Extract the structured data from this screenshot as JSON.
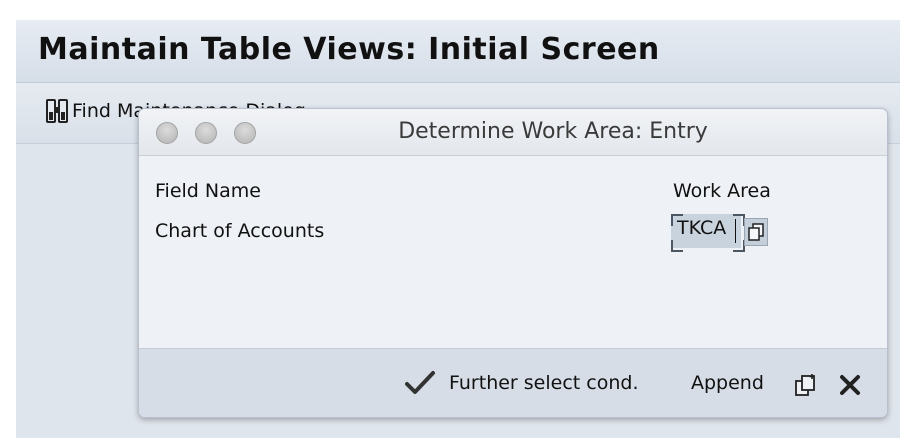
{
  "screen": {
    "title": "Maintain Table Views: Initial Screen",
    "toolbar": {
      "find_label": "Find Maintenance Dialog"
    }
  },
  "dialog": {
    "title": "Determine Work Area: Entry",
    "column_headers": {
      "field_name": "Field Name",
      "work_area": "Work Area"
    },
    "rows": [
      {
        "label": "Chart of Accounts",
        "value": "TKCA"
      }
    ],
    "footer": {
      "continue_icon": "checkmark-icon",
      "further_label": "Further select cond.",
      "append_label": "Append",
      "copy_icon": "copy-element-icon",
      "cancel_icon": "cancel-icon"
    }
  }
}
